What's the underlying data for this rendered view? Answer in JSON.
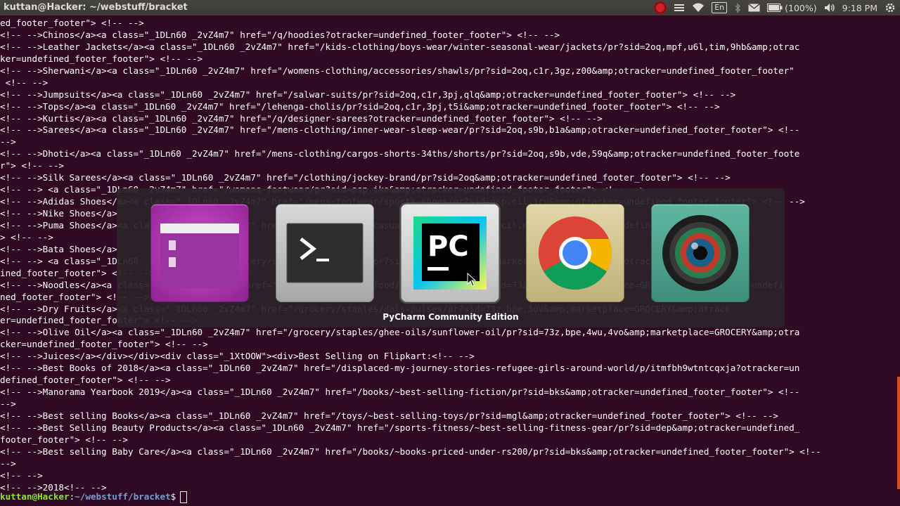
{
  "topbar": {
    "title": "kuttan@Hacker: ~/webstuff/bracket",
    "keyboard_layout": "En",
    "battery": "(100%)",
    "clock": "9:18 PM",
    "icons": [
      "record-icon",
      "mail-icon",
      "network-icon",
      "keyboard-icon",
      "bluetooth-icon",
      "email-icon",
      "battery-icon",
      "volume-icon",
      "power-gear-icon"
    ]
  },
  "terminal": {
    "lines": [
      "ed_footer_footer\"> <!-- -->",
      "<!-- -->Chinos</a><a class=\"_1DLn60 _2vZ4m7\" href=\"/q/hoodies?otracker=undefined_footer_footer\"> <!-- -->",
      "<!-- -->Leather Jackets</a><a class=\"_1DLn60 _2vZ4m7\" href=\"/kids-clothing/boys-wear/winter-seasonal-wear/jackets/pr?sid=2oq,mpf,u6l,tim,9hb&amp;otrac",
      "ker=undefined_footer_footer\"> <!-- -->",
      "<!-- -->Sherwani</a><a class=\"_1DLn60 _2vZ4m7\" href=\"/womens-clothing/accessories/shawls/pr?sid=2oq,c1r,3gz,z00&amp;otracker=undefined_footer_footer\"",
      " <!-- -->",
      "<!-- -->Jumpsuits</a><a class=\"_1DLn60 _2vZ4m7\" href=\"/salwar-suits/pr?sid=2oq,c1r,3pj,qlq&amp;otracker=undefined_footer_footer\"> <!-- -->",
      "<!-- -->Tops</a><a class=\"_1DLn60 _2vZ4m7\" href=\"/lehenga-cholis/pr?sid=2oq,c1r,3pj,t5i&amp;otracker=undefined_footer_footer\"> <!-- -->",
      "<!-- -->Kurtis</a><a class=\"_1DLn60 _2vZ4m7\" href=\"/q/designer-sarees?otracker=undefined_footer_footer\"> <!-- -->",
      "<!-- -->Sarees</a><a class=\"_1DLn60 _2vZ4m7\" href=\"/mens-clothing/inner-wear-sleep-wear/pr?sid=2oq,s9b,b1a&amp;otracker=undefined_footer_footer\"> <!--",
      "-->",
      "<!-- -->Dhoti</a><a class=\"_1DLn60 _2vZ4m7\" href=\"/mens-clothing/cargos-shorts-34ths/shorts/pr?sid=2oq,s9b,vde,59q&amp;otracker=undefined_footer_foote",
      "r\"> <!-- -->",
      "<!-- -->Silk Sarees</a><a class=\"_1DLn60 _2vZ4m7\" href=\"/clothing/jockey-brand/pr?sid=2oq&amp;otracker=undefined_footer_footer\"> <!-- -->",
      "<!-- --> <a class=\"_1DLn60 _2vZ4m7\" href=\"/womens-footwear/pr?sid=osp,iko&amp;otracker=undefined_footer_footer\"> <!-- -->",
      "<!-- -->Adidas Shoes</a><a class=\"_1DLn60 _2vZ4m7\" href=\"/mens-footwear/sports-shoes/pr?sid=osp,cil,1cu&amp;otracker=undefined_footer_footer\"> <!-- -->",
      "<!-- -->Nike Shoes</a>",
      "<!-- -->Puma Shoes</a><a class=\"_1DLn60 _2vZ4m7\" href=\"/mens-footwear/casual-shoes/pr?sid=osp,cil,e1f&amp;otracker=undefined_footer_footer\"",
      "> <!-- -->",
      "<!-- -->Bata Shoes</a>",
      "<!-- --> <a class=\"_1DLn60 _2vZ4m7\" href=\"/grocery/staples/dry-fruits/pr?sid=73z,bpe,fdl&amp;marketplace=GROCERY&amp;otracker=undef",
      "ined_footer_footer\"> <!-- -->",
      "<!-- -->Noodles</a><a class=\"_1DLn60 _2vZ4m7\" href=\"/grocery/packaged-food/noodles-pasta/pr?sid=73z,bpe&amp;marketplace=GROCERY&amp;otracker=undefi",
      "ned_footer_footer\"> <!-- -->",
      "<!-- -->Dry Fruits</a><a class=\"_1DLn60 _2vZ4m7\" href=\"/grocery/staples/dals-pulses/pr?sid=73z,bpe,3uv&amp;marketplace=GROCERY&amp;otrack",
      "er=undefined_footer_footer\"> <!-- -->",
      "<!-- -->Olive Oil</a><a class=\"_1DLn60 _2vZ4m7\" href=\"/grocery/staples/ghee-oils/sunflower-oil/pr?sid=73z,bpe,4wu,4vo&amp;marketplace=GROCERY&amp;otra",
      "cker=undefined_footer_footer\"> <!-- -->",
      "<!-- -->Juices</a></div></div><div class=\"_1XtOOW\"><div>Best Selling on Flipkart:<!-- -->",
      "<!-- -->Best Books of 2018</a><a class=\"_1DLn60 _2vZ4m7\" href=\"/displaced-my-journey-stories-refugee-girls-around-world/p/itmfbh9wtntcqxja?otracker=un",
      "defined_footer_footer\"> <!-- -->",
      "<!-- -->Manorama Yearbook 2019</a><a class=\"_1DLn60 _2vZ4m7\" href=\"/books/~best-selling-fiction/pr?sid=bks&amp;otracker=undefined_footer_footer\"> <!--",
      "-->",
      "<!-- -->Best selling Books</a><a class=\"_1DLn60 _2vZ4m7\" href=\"/toys/~best-selling-toys/pr?sid=mgl&amp;otracker=undefined_footer_footer\"> <!-- -->",
      "<!-- -->Best Selling Beauty Products</a><a class=\"_1DLn60 _2vZ4m7\" href=\"/sports-fitness/~best-selling-fitness-gear/pr?sid=dep&amp;otracker=undefined_",
      "footer_footer\"> <!-- -->",
      "<!-- -->Best selling Baby Care</a><a class=\"_1DLn60 _2vZ4m7\" href=\"/books/~books-priced-under-rs200/pr?sid=bks&amp;otracker=undefined_footer_footer\"> <!--",
      "-->",
      "<!-- -->",
      "<!-- -->2018<!-- -->"
    ],
    "prompt_user": "kuttan@Hacker",
    "prompt_colon": ":",
    "prompt_path": "~/webstuff/bracket",
    "prompt_dollar": "$"
  },
  "switcher": {
    "selected_label": "PyCharm Community Edition",
    "apps": [
      {
        "name": "Files",
        "icon": "files-icon"
      },
      {
        "name": "Terminal",
        "icon": "terminal-icon"
      },
      {
        "name": "PyCharm Community Edition",
        "icon": "pycharm-icon"
      },
      {
        "name": "Google Chrome",
        "icon": "chrome-icon"
      },
      {
        "name": "Camera",
        "icon": "camera-icon"
      }
    ]
  },
  "colors": {
    "terminal_bg": "#300a24",
    "prompt_user": "#8ae234",
    "prompt_path": "#729fcf",
    "accent": "#e95420"
  }
}
